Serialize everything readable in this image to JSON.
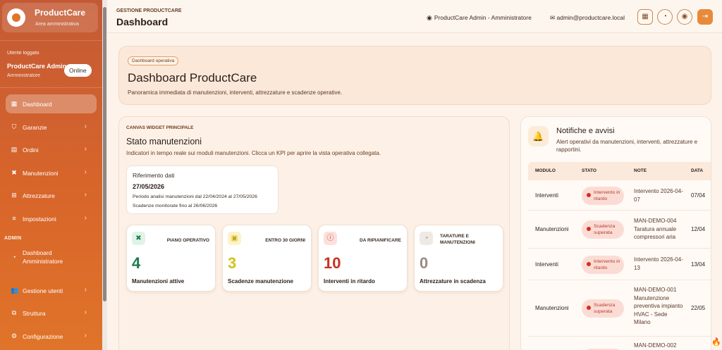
{
  "sidebar": {
    "brand_title": "ProductCare",
    "brand_sub": "Area amministrativa",
    "user_label": "Utente loggato",
    "user_name": "ProductCare Admin",
    "user_role": "Amministratore",
    "online_label": "Online",
    "items": [
      {
        "label": "Dashboard",
        "icon": "grid-icon"
      },
      {
        "label": "Garanzie",
        "icon": "shield-icon"
      },
      {
        "label": "Ordini",
        "icon": "document-icon"
      },
      {
        "label": "Manutenzioni",
        "icon": "tools-icon"
      },
      {
        "label": "Attrezzature",
        "icon": "boxes-icon"
      },
      {
        "label": "Impostazioni",
        "icon": "sliders-icon"
      }
    ],
    "admin_section": "ADMIN",
    "admin_items": [
      {
        "label": "Dashboard Amministratore",
        "icon": "gauge-icon"
      },
      {
        "label": "Gestione utenti",
        "icon": "users-icon"
      },
      {
        "label": "Struttura",
        "icon": "sitemap-icon"
      },
      {
        "label": "Configurazione",
        "icon": "gear-icon"
      }
    ]
  },
  "header": {
    "pre_title": "GESTIONE PRODUCTCARE",
    "title": "Dashboard",
    "user": "ProductCare Admin - Amministratore",
    "email": "admin@productcare.local"
  },
  "hero": {
    "chip": "Dashboard operativa",
    "title": "Dashboard ProductCare",
    "subtitle": "Panoramica immediata di manutenzioni, interventi, attrezzature e scadenze operative."
  },
  "canvas": {
    "pre_title": "CANVAS WIDGET PRINCIPALE",
    "title": "Stato manutenzioni",
    "subtitle": "Indicatori in tempo reale sui moduli manutenzioni. Clicca un KPI per aprire la vista operativa collegata.",
    "reference": {
      "label": "Riferimento dati",
      "date": "27/05/2026",
      "line1": "Periodo analisi manutenzioni dal 22/04/2024 al 27/05/2026",
      "line2": "Scadenze monitorate fino al 26/06/2026"
    },
    "kpis": [
      {
        "label": "PIANO OPERATIVO",
        "value": "4",
        "caption": "Manutenzioni attive",
        "color": "#1f7a4f",
        "icon": "tools-icon",
        "icon_bg": "#dff3e6"
      },
      {
        "label": "ENTRO 30 GIORNI",
        "value": "3",
        "caption": "Scadenze manutenzione",
        "color": "#d4c21c",
        "icon": "calendar-icon",
        "icon_bg": "#fdf3c4"
      },
      {
        "label": "DA RIPIANIFICARE",
        "value": "10",
        "caption": "Interventi in ritardo",
        "color": "#c6321f",
        "icon": "alert-icon",
        "icon_bg": "#fde0dc"
      },
      {
        "label": "TARATURE E MANUTENZIONI",
        "value": "0",
        "caption": "Attrezzature in scadenza",
        "color": "#9a8a7e",
        "icon": "gauge-icon",
        "icon_bg": "#efe9e4"
      }
    ]
  },
  "notifications": {
    "title": "Notifiche e avvisi",
    "subtitle": "Alert operativi da manutenzioni, interventi, attrezzature e rapportini.",
    "columns": [
      "MODULO",
      "STATO",
      "NOTE",
      "DATA"
    ],
    "rows": [
      {
        "module": "Interventi",
        "status": "Intervento in ritardo",
        "note": "Intervento 2026-04-07",
        "date": "07/04"
      },
      {
        "module": "Manutenzioni",
        "status": "Scadenza superata",
        "note": "MAN-DEMO-004 Taratura annuale compressori aria",
        "date": "12/04"
      },
      {
        "module": "Interventi",
        "status": "Intervento in ritardo",
        "note": "Intervento 2026-04-13",
        "date": "13/04"
      },
      {
        "module": "Manutenzioni",
        "status": "Scadenza superata",
        "note": "MAN-DEMO-001 Manutenzione preventiva impianto HVAC - Sede Milano",
        "date": "22/05"
      },
      {
        "module": "",
        "status": "",
        "note": "MAN-DEMO-002",
        "date": ""
      }
    ]
  }
}
